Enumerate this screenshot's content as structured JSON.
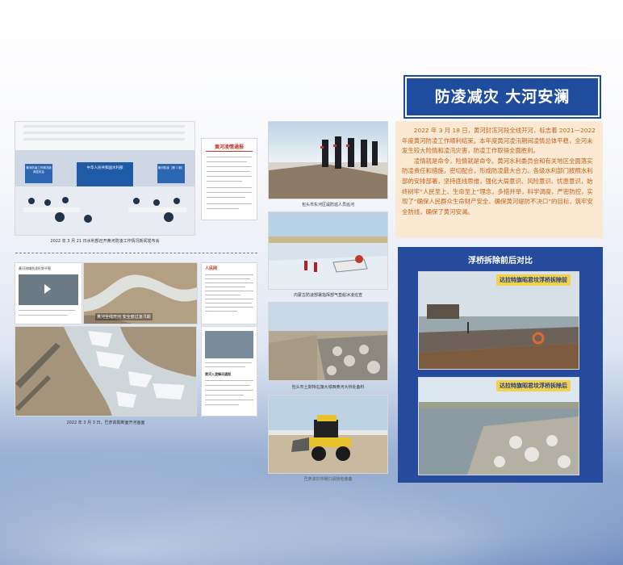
{
  "title": "防凌减灾 大河安澜",
  "intro_paragraphs": [
    "2022 年 3 月 18 日，黄河封冻河段全线开河，标志着 2021—2022 年度黄河防凌工作顺利结束。本年度黄河凌汛期间凌情总体平稳，全河未发生较大险情和凌汛灾害，防凌工作取得全面胜利。",
    "凌情就是命令，险情就是命令。黄河水利委员会和有关地区全面落实防凌责任和措施，密切配合，形成防凌最大合力。各级水利部门按照水利部的安排部署，坚持底线思维，强化大局意识、风险意识、忧患意识，始终树牢“人民至上、生命至上”理念，多措并举，科学调度，严密防控，实现了“确保人民群众生命财产安全、确保黄河堤防不决口”的目标，筑牢安全防线，确保了黄河安澜。"
  ],
  "captions": {
    "press": "2022 年 3 月 21 日水利部召开黄河防凌工作情况新闻发布会",
    "aerial": "2022 年 3 月 3 日，巴彦高勒断面开河画面",
    "patrol": "包头市东河区堤防巡人员巡河",
    "airboat": "内蒙古防凌部署指挥部气垫船冰凌巡查",
    "dike": "包头市土默特右旗大城西黄河大桥处备料",
    "loader": "巴彦淖尔市磴口县抢险装备"
  },
  "screen_texts": {
    "stage_banner": "中华人民共和国水利部",
    "left_screen": "黄河防凌工作情况新闻发布会",
    "right_screen": "黄河防凌（第 1 期）",
    "bulletin_title": "黄河凌情通报",
    "video_overlay": "黄河全线开河 安全度过凌汛期",
    "web_title_1": "黄河流域防凌形势平稳",
    "web_title_2": "黄河入凌情况通报",
    "web_brand": "人民网"
  },
  "comparison": {
    "title": "浮桥拆除前后对比",
    "before_label": "达拉特旗昭君坟浮桥拆除前",
    "after_label": "达拉特旗昭君坟浮桥拆除后"
  },
  "colors": {
    "banner_blue": "#1f4d9e",
    "text_orange": "#c0611c",
    "textbox_bg": "#fbe9d3",
    "label_yellow": "#f3d14b"
  }
}
